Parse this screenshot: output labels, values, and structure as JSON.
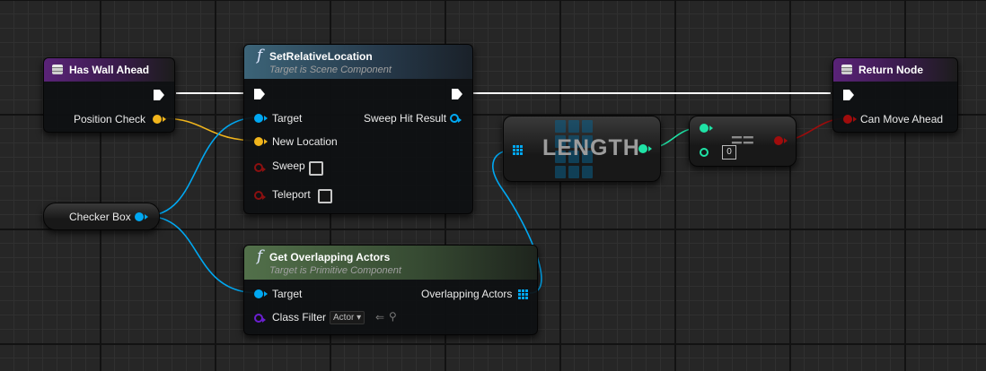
{
  "nodes": {
    "has_wall_ahead": {
      "title": "Has Wall Ahead",
      "pins": {
        "position_check": "Position Check"
      }
    },
    "set_relative_location": {
      "title": "SetRelativeLocation",
      "subtitle": "Target is Scene Component",
      "pins": {
        "target": "Target",
        "sweep_hit_result": "Sweep Hit Result",
        "new_location": "New Location",
        "sweep": "Sweep",
        "teleport": "Teleport"
      }
    },
    "return_node": {
      "title": "Return Node",
      "pins": {
        "can_move_ahead": "Can Move Ahead"
      }
    },
    "checker_box": {
      "label": "Checker Box"
    },
    "length": {
      "label": "LENGTH"
    },
    "equal": {
      "symbol": "==",
      "default_value": "0"
    },
    "get_overlapping_actors": {
      "title": "Get Overlapping Actors",
      "subtitle": "Target is Primitive Component",
      "pins": {
        "target": "Target",
        "overlapping_actors": "Overlapping Actors",
        "class_filter": "Class Filter",
        "class_filter_value": "Actor"
      }
    }
  },
  "icons": {
    "function": "f",
    "event": "event-node-icon",
    "exec": "exec-pin-icon"
  },
  "colors": {
    "background": "#262626",
    "grid_major": "#121212",
    "grid_minor": "#303030",
    "event_header": "#5a2378",
    "function_header": "#3c6478",
    "pure_function_header": "#52704a",
    "exec_wire": "#ffffff",
    "vector_pin": "#f1b51c",
    "object_pin": "#00a8f2",
    "integer_pin": "#1fe3a6",
    "boolean_pin": "#a00c0c",
    "class_pin": "#6a1fd0"
  }
}
